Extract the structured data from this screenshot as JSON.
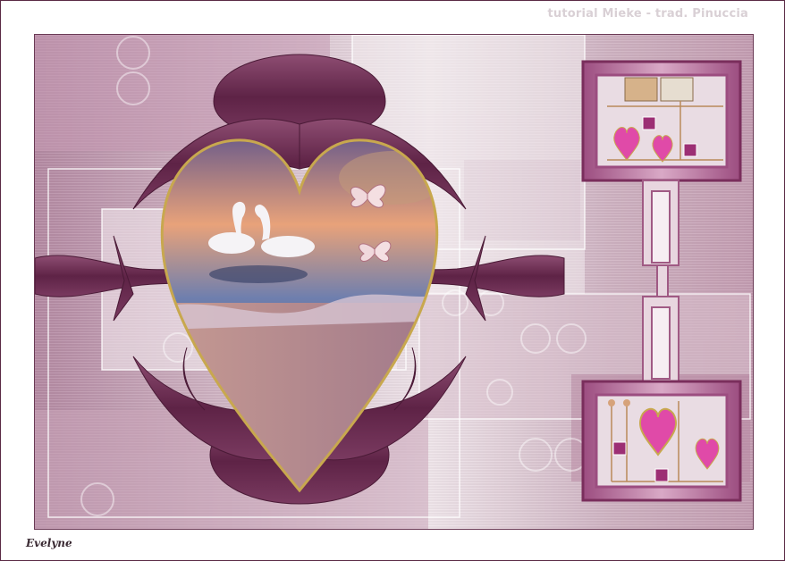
{
  "watermark": "tutorial Mieke - trad. Pinuccia",
  "signature": "Evelyne",
  "palette": {
    "plum_dark": "#5e2346",
    "plum_mid": "#8e4d72",
    "pink_light": "#e8d6df",
    "heart_pink": "#e04aa8",
    "gold": "#c8a84e"
  },
  "scene": {
    "central_image": "swans-heart",
    "decorations": [
      "butterfly-icon",
      "butterfly-icon",
      "heart-icon",
      "heart-icon",
      "heart-icon",
      "heart-icon"
    ]
  }
}
